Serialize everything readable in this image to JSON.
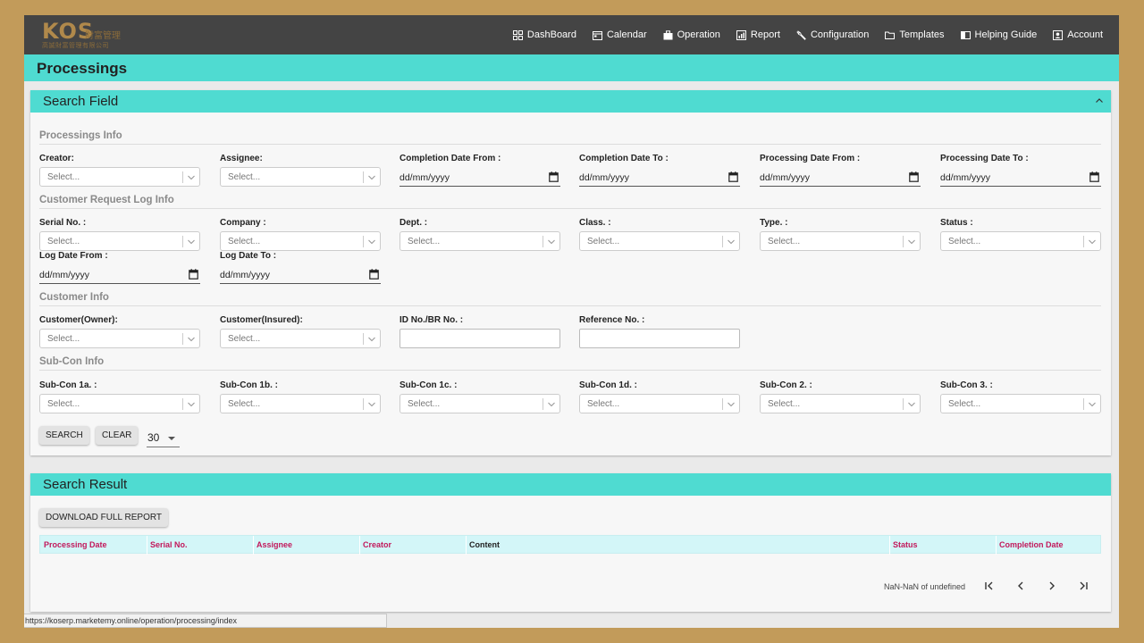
{
  "logo": {
    "text": "KOS",
    "cjk": "財富管理",
    "sub": "高誠財富管理有限公司"
  },
  "nav": [
    {
      "label": "DashBoard",
      "icon": "dashboard-icon"
    },
    {
      "label": "Calendar",
      "icon": "calendar-icon"
    },
    {
      "label": "Operation",
      "icon": "briefcase-icon"
    },
    {
      "label": "Report",
      "icon": "report-icon"
    },
    {
      "label": "Configuration",
      "icon": "wrench-icon"
    },
    {
      "label": "Templates",
      "icon": "folder-icon"
    },
    {
      "label": "Helping Guide",
      "icon": "book-icon"
    },
    {
      "label": "Account",
      "icon": "account-icon"
    }
  ],
  "page_title": "Processings",
  "search_panel": {
    "title": "Search Field",
    "sections": {
      "processings": "Processings Info",
      "customer_request": "Customer Request Log Info",
      "customer": "Customer Info",
      "subcon": "Sub-Con Info"
    },
    "select_placeholder": "Select...",
    "date_placeholder": "dd/mm/yyyy",
    "processings_fields": {
      "creator": "Creator:",
      "assignee": "Assignee:",
      "completion_from": "Completion Date From :",
      "completion_to": "Completion Date To :",
      "processing_from": "Processing Date From :",
      "processing_to": "Processing Date To :"
    },
    "request_fields": {
      "serial": "Serial No. :",
      "company": "Company :",
      "dept": "Dept. :",
      "class": "Class. :",
      "type": "Type. :",
      "status": "Status :",
      "log_from": "Log Date From :",
      "log_to": "Log Date To :"
    },
    "customer_fields": {
      "owner": "Customer(Owner):",
      "insured": "Customer(Insured):",
      "id_no": "ID No./BR No. :",
      "reference": "Reference No. :"
    },
    "subcon_fields": {
      "s1a": "Sub-Con 1a. :",
      "s1b": "Sub-Con 1b. :",
      "s1c": "Sub-Con 1c. :",
      "s1d": "Sub-Con 1d. :",
      "s2": "Sub-Con 2. :",
      "s3": "Sub-Con 3. :"
    },
    "search_button": "SEARCH",
    "clear_button": "CLEAR",
    "page_size": "30"
  },
  "result_panel": {
    "title": "Search Result",
    "download_button": "DOWNLOAD FULL REPORT",
    "columns": [
      "Processing Date",
      "Serial No.",
      "Assignee",
      "Creator",
      "Content",
      "Status",
      "Completion Date"
    ],
    "pager_text": "NaN-NaN of undefined"
  },
  "status_url": "https://koserp.marketemy.online/operation/processing/index",
  "colors": {
    "accent": "#4fdbd1",
    "header_bg": "#444444",
    "column_text": "#c2185b"
  }
}
